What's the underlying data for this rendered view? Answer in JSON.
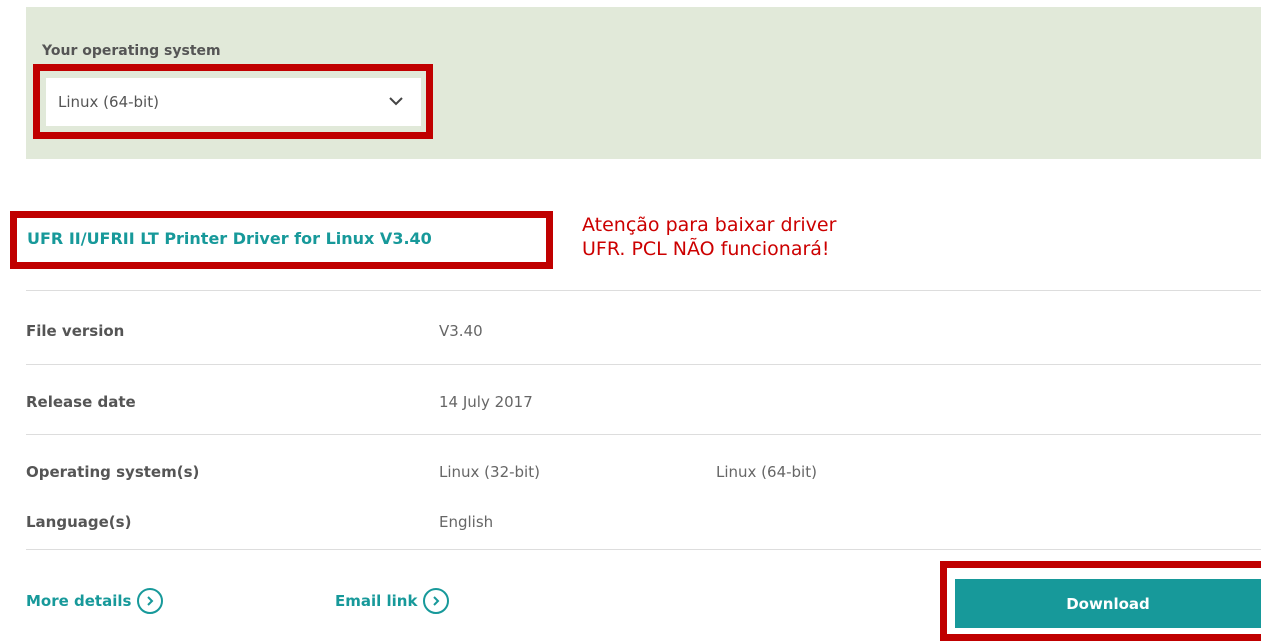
{
  "os_section": {
    "label": "Your operating system",
    "selected": "Linux (64-bit)"
  },
  "driver": {
    "title": "UFR II/UFRII LT Printer Driver for Linux V3.40"
  },
  "annotation": {
    "line1": "Atenção para baixar driver",
    "line2": "UFR. PCL NÃO funcionará!",
    "color": "#cc0000"
  },
  "details": {
    "file_version": {
      "label": "File version",
      "value": "V3.40"
    },
    "release_date": {
      "label": "Release date",
      "value": "14 July 2017"
    },
    "operating_systems": {
      "label": "Operating system(s)",
      "values": [
        "Linux (32-bit)",
        "Linux (64-bit)"
      ]
    },
    "languages": {
      "label": "Language(s)",
      "value": "English"
    }
  },
  "actions": {
    "more_details": "More details",
    "email_link": "Email link",
    "download": "Download"
  },
  "colors": {
    "accent": "#17999a",
    "panel_bg": "#e1e9d9",
    "highlight": "#c00000"
  }
}
